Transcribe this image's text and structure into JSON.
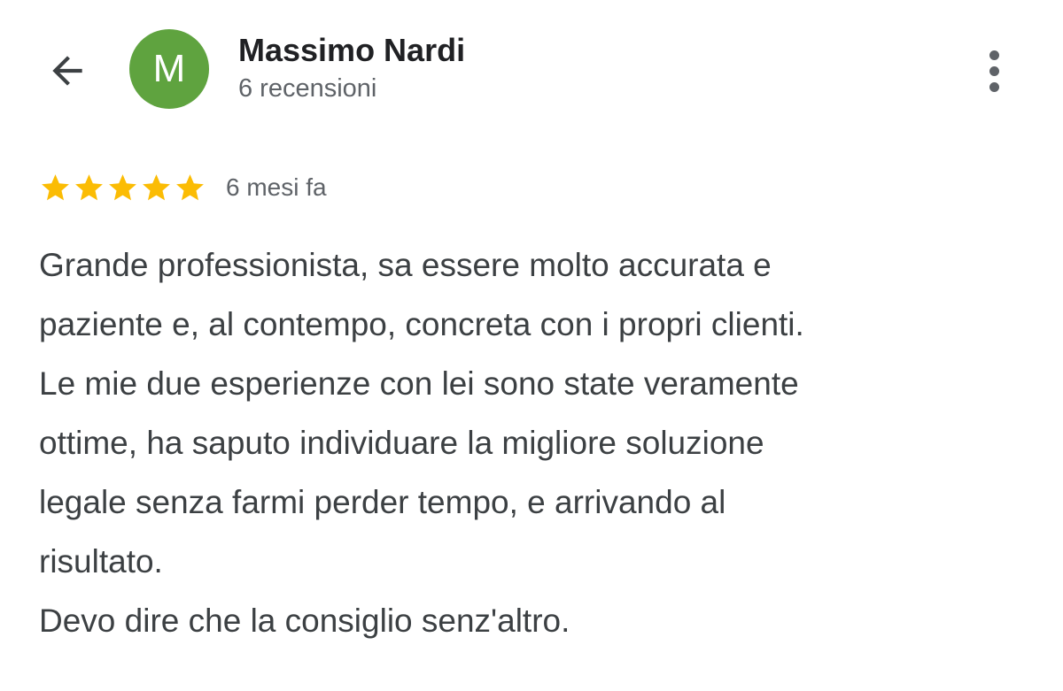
{
  "header": {
    "back_icon": "arrow-back-icon",
    "avatar_initial": "M",
    "avatar_color": "#5fa33f",
    "user_name": "Massimo Nardi",
    "review_count": "6 recensioni",
    "more_icon": "more-vertical-icon"
  },
  "review": {
    "rating": 5,
    "rating_max": 5,
    "star_color": "#fbbc04",
    "date": "6 mesi fa",
    "lines": [
      "Grande professionista, sa essere molto accurata e",
      "paziente e, al contempo, concreta con i propri clienti.",
      "Le mie due esperienze con lei sono state veramente",
      "ottime, ha saputo individuare la migliore soluzione",
      "legale senza farmi perder tempo, e arrivando al",
      "risultato.",
      "Devo dire che la consiglio senz'altro."
    ]
  }
}
